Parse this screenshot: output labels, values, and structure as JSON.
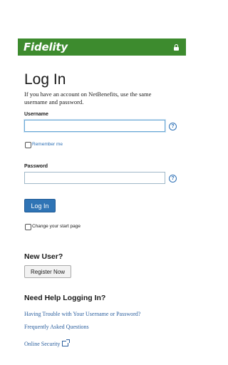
{
  "header": {
    "logo": "Fidelity"
  },
  "login": {
    "title": "Log In",
    "intro": "If you have an account on NetBenefits, use the same username and password.",
    "username_label": "Username",
    "username_value": "",
    "remember_label": "Remember me",
    "password_label": "Password",
    "password_value": "",
    "help_glyph": "?",
    "submit_label": "Log In",
    "change_start_label": "Change your start page"
  },
  "new_user": {
    "title": "New User?",
    "register_label": "Register Now"
  },
  "help": {
    "title": "Need Help Logging In?",
    "links": [
      "Having Trouble with Your Username or Password?",
      "Frequently Asked Questions",
      "Online Security"
    ]
  },
  "colors": {
    "brand_green": "#3d8b2e",
    "link_blue": "#2b5f9e",
    "button_blue": "#2f74b5"
  }
}
